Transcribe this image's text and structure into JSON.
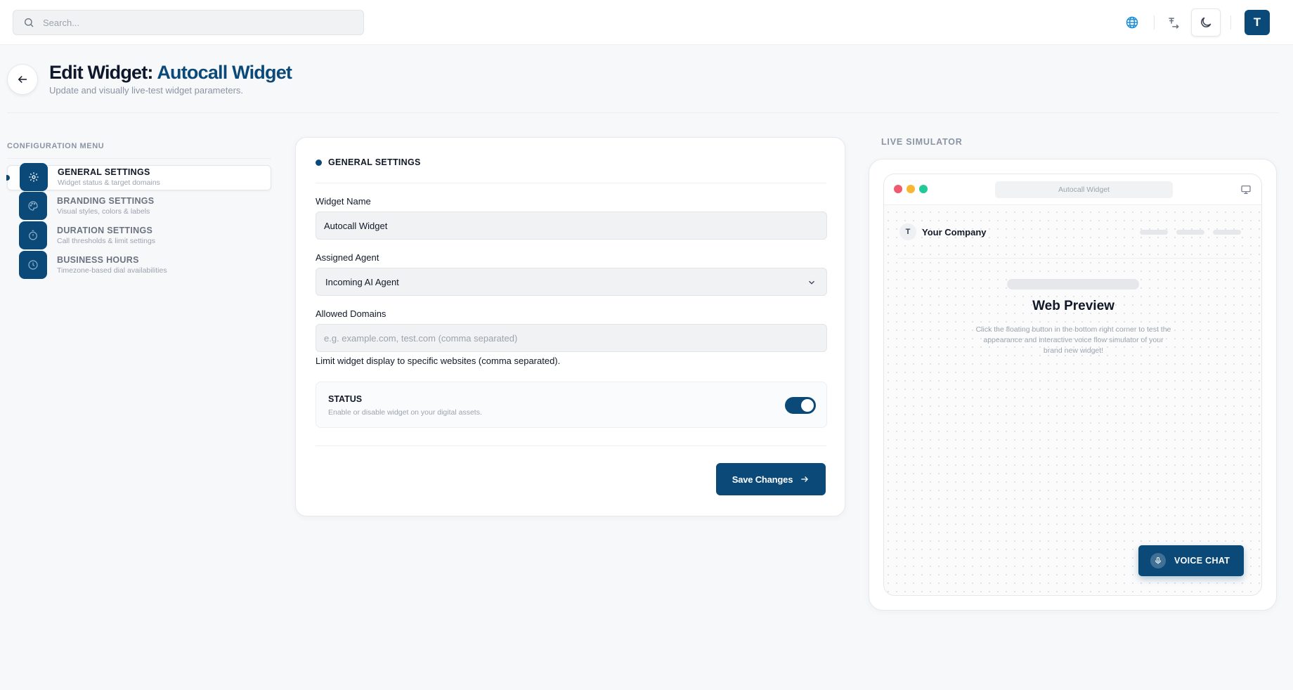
{
  "colors": {
    "primary": "#0b4a78",
    "traffic_red": "#f05a6e",
    "traffic_yellow": "#f7b731",
    "traffic_green": "#20c997"
  },
  "topbar": {
    "search_placeholder": "Search...",
    "icons": [
      "search-icon",
      "globe-icon",
      "translate-icon",
      "moon-icon"
    ],
    "avatar_initial": "T"
  },
  "header": {
    "title_prefix": "Edit Widget:",
    "title_accent": "Autocall Widget",
    "subtitle": "Update and visually live-test widget parameters."
  },
  "menu": {
    "label": "CONFIGURATION MENU",
    "items": [
      {
        "title": "GENERAL SETTINGS",
        "desc": "Widget status & target domains",
        "icon": "gear-icon",
        "active": true
      },
      {
        "title": "BRANDING SETTINGS",
        "desc": "Visual styles, colors & labels",
        "icon": "palette-icon",
        "active": false
      },
      {
        "title": "DURATION SETTINGS",
        "desc": "Call thresholds & limit settings",
        "icon": "stopwatch-icon",
        "active": false
      },
      {
        "title": "BUSINESS HOURS",
        "desc": "Timezone-based dial availabilities",
        "icon": "clock-icon",
        "active": false
      }
    ]
  },
  "form": {
    "section_title": "GENERAL SETTINGS",
    "widget_name_label": "Widget Name",
    "widget_name_value": "Autocall Widget",
    "agent_label": "Assigned Agent",
    "agent_value": "Incoming AI Agent",
    "domains_label": "Allowed Domains",
    "domains_placeholder": "e.g. example.com, test.com (comma separated)",
    "domains_help": "Limit widget display to specific websites (comma separated).",
    "status_title": "STATUS",
    "status_desc": "Enable or disable widget on your digital assets.",
    "status_enabled": true,
    "save_label": "Save Changes"
  },
  "simulator": {
    "label": "LIVE SIMULATOR",
    "url_text": "Autocall Widget",
    "site_logo": "T",
    "site_name": "Your Company",
    "preview_title": "Web Preview",
    "preview_desc": "Click the floating button in the bottom right corner to test the appearance and interactive voice flow simulator of your brand new widget!",
    "voice_button": "VOICE CHAT"
  }
}
